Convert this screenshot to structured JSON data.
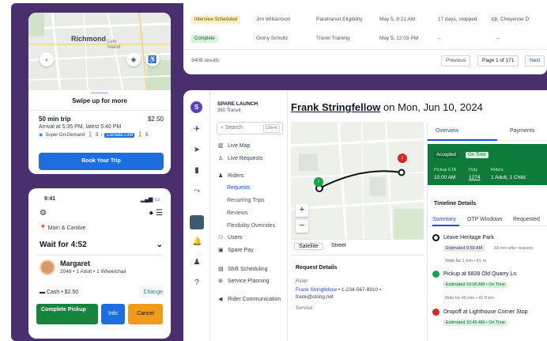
{
  "trip_card": {
    "map_label": "Richmond",
    "map_label_2": "Lulu Island",
    "swipe_text": "Swipe up for more",
    "duration": "50 min trip",
    "price": "$2.50",
    "arrival": "Arrival at 5:35 PM, latest 5:40 PM",
    "service_1": "Super On-Demand",
    "service_1_num": "5",
    "service_2": "Canada Line",
    "service_2_num": "5",
    "book_label": "Book Your Trip"
  },
  "driver_card": {
    "time": "9:41",
    "signal": "▂▄▆ ▭",
    "location": "Main & Cambie",
    "wait": "Wait for 4:52",
    "rider_name": "Margaret",
    "rider_detail": "2048 • 1 Adult • 1 Wheelchair",
    "payment": "Cash • $2.50",
    "change_label": "Change",
    "complete_label": "Complete Pickup",
    "info_label": "Info",
    "cancel_label": "Cancel"
  },
  "table": {
    "rows": [
      {
        "status": "Interview Scheduled",
        "name": "Jim Williamson",
        "type": "Paratransit Eligibility",
        "date": "May 5, 8:21 AM",
        "age": "17 days, stopped",
        "assignee": "Cheyenne D"
      },
      {
        "status": "Complete",
        "name": "Ginny Schultz",
        "type": "Travel Training",
        "date": "May 5, 12:03 PM",
        "age": "–",
        "assignee": "–"
      }
    ],
    "results": "3409 results",
    "prev_label": "Previous",
    "page_label": "Page 1 of 171",
    "next_label": "Next"
  },
  "app": {
    "logo_letter": "S",
    "org_name": "SPARE LAUNCH",
    "org_sub": "360 Transit",
    "search_placeholder": "Search",
    "search_kbd": "Ctrl+K",
    "nav": {
      "live_map": "Live Map",
      "live_requests": "Live Requests",
      "riders": "Riders",
      "requests": "Requests",
      "recurring_trips": "Recurring Trips",
      "reviews": "Reviews",
      "flexibility_overrides": "Flexibility Overrides",
      "users": "Users",
      "spare_pay": "Spare Pay",
      "shift_scheduling": "Shift Scheduling",
      "service_planning": "Service Planning",
      "rider_communication": "Rider Communication"
    },
    "title_name": "Frank Stringfellow",
    "title_rest": " on Mon, Jun 10, 2024",
    "map_tab_satellite": "Satellite",
    "map_tab_street": "Street",
    "request_details": {
      "heading": "Request Details",
      "rider_label": "Rider",
      "rider_name": "Frank Stringfellow",
      "rider_phone": " • 1-234-567-8910 •",
      "rider_email": "frank@string.net",
      "service_label": "Service"
    },
    "right_tabs": {
      "overview": "Overview",
      "payments": "Payments"
    },
    "status": {
      "accepted": "Accepted",
      "on_time": "On Time",
      "pickup_eta_label": "Pickup ETA",
      "pickup_eta": "10:00 AM",
      "duty_label": "Duty",
      "duty": "1274",
      "riders_label": "Riders",
      "riders": "1 Adult, 1 Child"
    },
    "timeline": {
      "heading": "Timeline Details",
      "tabs": [
        "Summary",
        "OTP Windows",
        "Requested"
      ],
      "ev1": "Leave Heritage Park",
      "ev1_chip": "Estimated 9:59 AM",
      "ev1_note": "33 min after request",
      "ev1_walk": "Walk for 1 min • 61 m",
      "ev2": "Pickup at 6828 Old Quarry Ln",
      "ev2_chip": "Estimated 10:00 AM • On Time",
      "ev2_ride": "Ride for 45 min • 41.9 km",
      "ev3": "Dropoff at Lighthouse Corner Stop",
      "ev3_chip": "Estimated 10:45 AM • On Time"
    }
  },
  "colors": {
    "background": "#4a2f6e",
    "primary_blue": "#1d6fe0",
    "success_green": "#15843c",
    "cancel_orange": "#f29a1a"
  }
}
